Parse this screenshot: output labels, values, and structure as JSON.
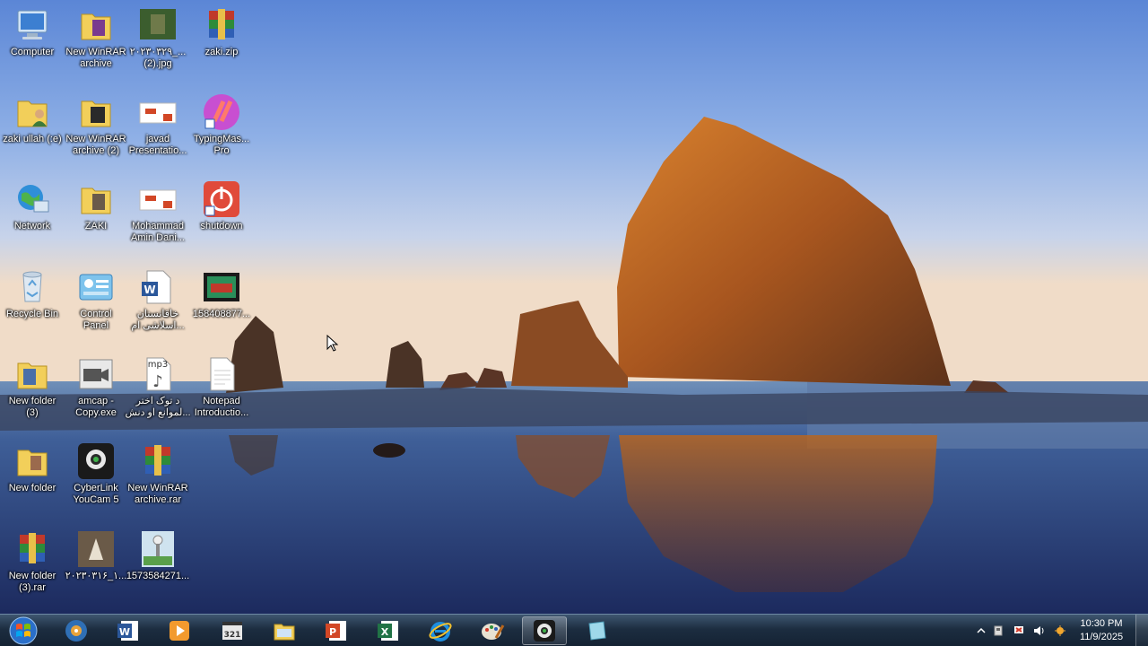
{
  "desktop": {
    "icons": [
      {
        "label": "Computer",
        "icon": "computer-icon"
      },
      {
        "label": "New WinRAR\narchive",
        "icon": "winrar-folder-icon"
      },
      {
        "label": "۲۰۲۳۰۳۲۹_...\n(2).jpg",
        "icon": "image-file-icon"
      },
      {
        "label": "zaki.zip",
        "icon": "winrar-icon"
      },
      {
        "label": "zaki ullah (:e)",
        "icon": "user-folder-icon"
      },
      {
        "label": "New WinRAR\narchive (2)",
        "icon": "winrar-folder-icon"
      },
      {
        "label": "javad\nPresentatio...",
        "icon": "powerpoint-file-icon"
      },
      {
        "label": "TypingMas...\nPro",
        "icon": "typingmaster-icon"
      },
      {
        "label": "Network",
        "icon": "network-icon"
      },
      {
        "label": "ZAKI",
        "icon": "folder-icon"
      },
      {
        "label": "Mohammad\nAmin Dani...",
        "icon": "powerpoint-file-icon"
      },
      {
        "label": "shutdown",
        "icon": "shutdown-icon"
      },
      {
        "label": "Recycle Bin",
        "icon": "recycle-bin-icon"
      },
      {
        "label": "Control\nPanel",
        "icon": "control-panel-icon"
      },
      {
        "label": "خاقانستان\nاسلاشی ام...",
        "icon": "word-file-icon"
      },
      {
        "label": "158408877...",
        "icon": "video-file-icon"
      },
      {
        "label": "New folder\n(3)",
        "icon": "folder-icon"
      },
      {
        "label": "amcap -\nCopy.exe",
        "icon": "amcap-icon"
      },
      {
        "label": "د توک اختر\nلموانع او دنش...",
        "icon": "mp3-file-icon"
      },
      {
        "label": "Notepad\nIntroductio...",
        "icon": "text-file-icon"
      },
      {
        "label": "New folder",
        "icon": "folder-icon"
      },
      {
        "label": "CyberLink\nYouCam 5",
        "icon": "youcam-icon"
      },
      {
        "label": "New WinRAR\narchive.rar",
        "icon": "winrar-icon"
      },
      {
        "label": "New folder\n(3).rar",
        "icon": "winrar-icon"
      },
      {
        "label": "۲۰۲۳۰۳۱۶_۱...",
        "icon": "image-file-icon"
      },
      {
        "label": "1573584271...",
        "icon": "image-file-icon"
      }
    ]
  },
  "taskbar": {
    "pinned": [
      {
        "name": "media-center-icon"
      },
      {
        "name": "word-icon"
      },
      {
        "name": "media-player-icon"
      },
      {
        "name": "video-editor-icon"
      },
      {
        "name": "file-explorer-icon"
      },
      {
        "name": "powerpoint-icon"
      },
      {
        "name": "excel-icon"
      },
      {
        "name": "internet-explorer-icon"
      },
      {
        "name": "paint-icon"
      },
      {
        "name": "webcam-icon"
      },
      {
        "name": "notes-icon"
      }
    ],
    "clock": {
      "time": "10:30 PM",
      "date": "11/9/2025"
    }
  },
  "colors": {
    "sky_top": "#5b86d6",
    "sky_bottom": "#f0dcc8",
    "rock": "#b25f22",
    "water": "#23356a"
  }
}
